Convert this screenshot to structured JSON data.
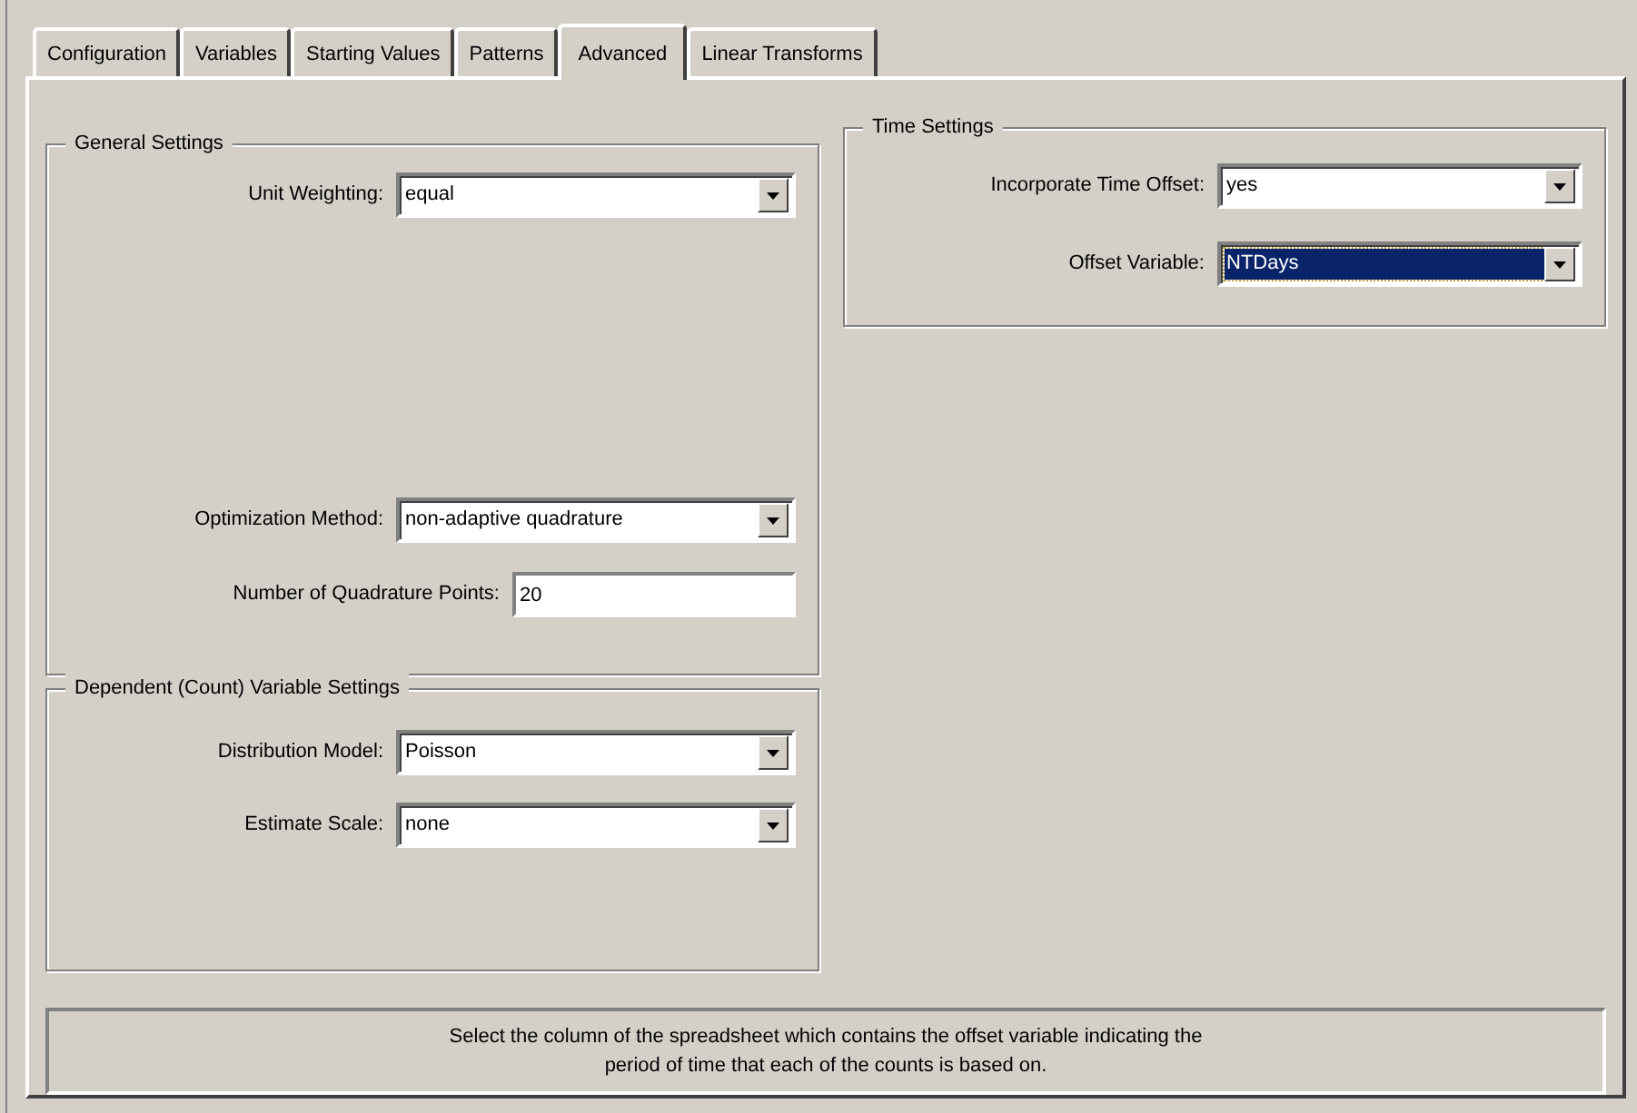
{
  "tabs": [
    {
      "label": "Configuration",
      "selected": false
    },
    {
      "label": "Variables",
      "selected": false
    },
    {
      "label": "Starting Values",
      "selected": false
    },
    {
      "label": "Patterns",
      "selected": false
    },
    {
      "label": "Advanced",
      "selected": true
    },
    {
      "label": "Linear Transforms",
      "selected": false
    }
  ],
  "general_settings": {
    "title": "General Settings",
    "fields": [
      {
        "kind": "combo",
        "label": "Unit Weighting:",
        "value": "equal",
        "focused": false
      },
      {
        "kind": "combo",
        "label": "Optimization Method:",
        "value": "non-adaptive quadrature",
        "focused": false
      },
      {
        "kind": "text",
        "label": "Number of Quadrature Points:",
        "value": "20"
      }
    ]
  },
  "dependent_variable_settings": {
    "title": "Dependent (Count) Variable Settings",
    "fields": [
      {
        "kind": "combo",
        "label": "Distribution Model:",
        "value": "Poisson",
        "focused": false
      },
      {
        "kind": "combo",
        "label": "Estimate Scale:",
        "value": "none",
        "focused": false
      }
    ]
  },
  "time_settings": {
    "title": "Time Settings",
    "fields": [
      {
        "kind": "combo",
        "label": "Incorporate Time Offset:",
        "value": "yes",
        "focused": false
      },
      {
        "kind": "combo",
        "label": "Offset Variable:",
        "value": "NTDays",
        "focused": true
      }
    ]
  },
  "help_text": "Select the column of the spreadsheet which contains the offset variable indicating the period of time that each of the counts is based on."
}
